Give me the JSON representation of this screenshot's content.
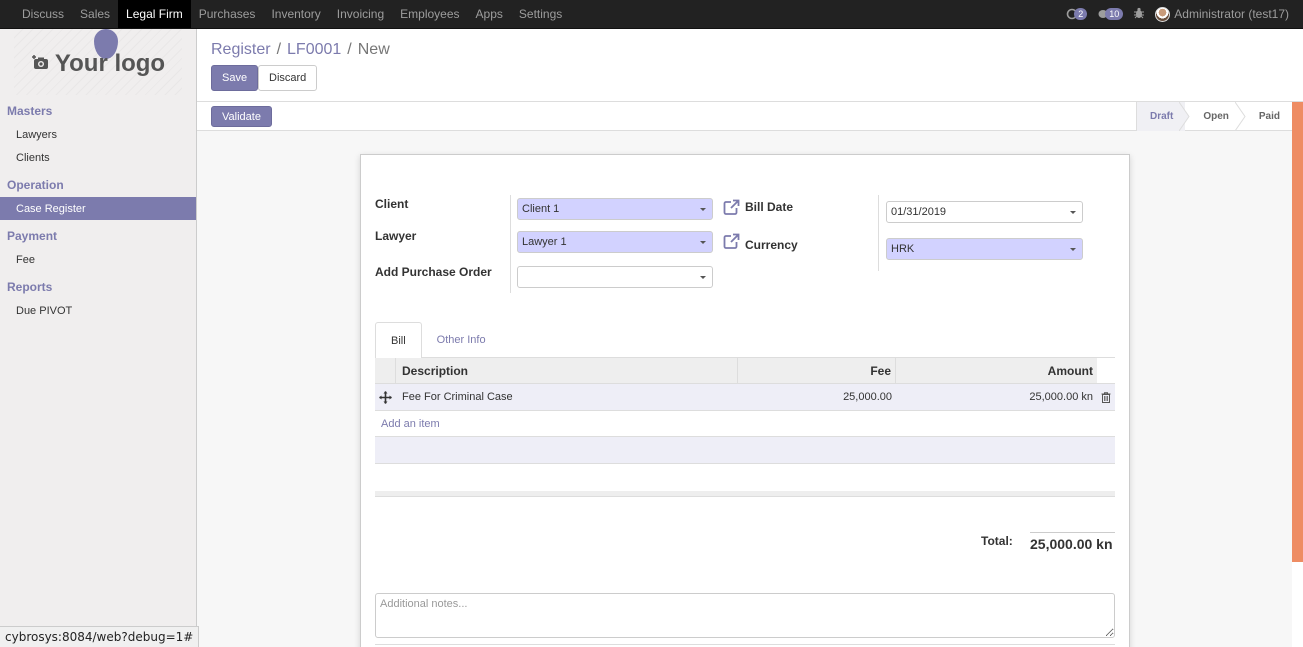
{
  "topbar": {
    "menu": [
      {
        "label": "Discuss",
        "active": false
      },
      {
        "label": "Sales",
        "active": false
      },
      {
        "label": "Legal Firm",
        "active": true
      },
      {
        "label": "Purchases",
        "active": false
      },
      {
        "label": "Inventory",
        "active": false
      },
      {
        "label": "Invoicing",
        "active": false
      },
      {
        "label": "Employees",
        "active": false
      },
      {
        "label": "Apps",
        "active": false
      },
      {
        "label": "Settings",
        "active": false
      }
    ],
    "activity_count": "2",
    "messages_count": "10",
    "user_name": "Administrator (test17)"
  },
  "sidebar": {
    "logo_text": "Your logo",
    "sections": [
      {
        "title": "Masters",
        "items": [
          {
            "label": "Lawyers",
            "active": false
          },
          {
            "label": "Clients",
            "active": false
          }
        ]
      },
      {
        "title": "Operation",
        "items": [
          {
            "label": "Case Register",
            "active": true
          }
        ]
      },
      {
        "title": "Payment",
        "items": [
          {
            "label": "Fee",
            "active": false
          }
        ]
      },
      {
        "title": "Reports",
        "items": [
          {
            "label": "Due PIVOT",
            "active": false
          }
        ]
      }
    ]
  },
  "control": {
    "breadcrumb": [
      "Register",
      "LF0001",
      "New"
    ],
    "separator": "/",
    "save_label": "Save",
    "discard_label": "Discard"
  },
  "statusbar": {
    "validate_label": "Validate",
    "steps": [
      "Draft",
      "Open",
      "Paid"
    ],
    "current_step": "Draft"
  },
  "form": {
    "client_label": "Client",
    "client_value": "Client 1",
    "lawyer_label": "Lawyer",
    "lawyer_value": "Lawyer 1",
    "purchase_order_label": "Add Purchase Order",
    "purchase_order_value": "",
    "bill_date_label": "Bill Date",
    "bill_date_value": "01/31/2019",
    "currency_label": "Currency",
    "currency_value": "HRK"
  },
  "tabs": [
    {
      "label": "Bill",
      "active": true
    },
    {
      "label": "Other Info",
      "active": false
    }
  ],
  "grid": {
    "columns": [
      "Description",
      "Fee",
      "Amount"
    ],
    "rows": [
      {
        "description": "Fee For Criminal Case",
        "fee": "25,000.00",
        "amount": "25,000.00 kn"
      }
    ],
    "add_item_label": "Add an item"
  },
  "totals": {
    "label": "Total:",
    "value": "25,000.00 kn"
  },
  "notes": {
    "placeholder": "Additional notes...",
    "value": ""
  },
  "browser_status": "cybrosys:8084/web?debug=1#",
  "colors": {
    "brand": "#7c7bad",
    "required_field": "#d2d2ff",
    "scroll_accent": "#ee8c63",
    "topbar": "#222222"
  }
}
